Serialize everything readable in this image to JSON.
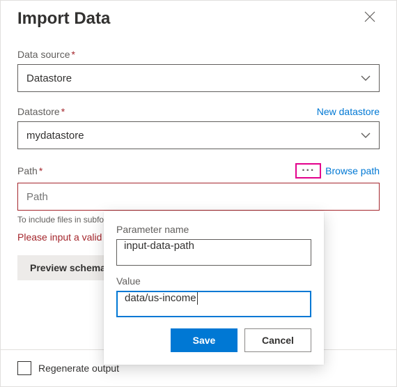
{
  "header": {
    "title": "Import Data"
  },
  "fields": {
    "data_source": {
      "label": "Data source",
      "value": "Datastore"
    },
    "datastore": {
      "label": "Datastore",
      "new_link": "New datastore",
      "value": "mydatastore"
    },
    "path": {
      "label": "Path",
      "browse_link": "Browse path",
      "placeholder": "Path",
      "hint": "To include files in subfolder, append '/**' after the folder name like '{folder}/**'.",
      "error": "Please input a valid path."
    }
  },
  "buttons": {
    "preview": "Preview schema"
  },
  "footer": {
    "regenerate": "Regenerate output"
  },
  "popover": {
    "param_label": "Parameter name",
    "param_value": "input-data-path",
    "value_label": "Value",
    "value_value": "data/us-income",
    "save": "Save",
    "cancel": "Cancel"
  }
}
